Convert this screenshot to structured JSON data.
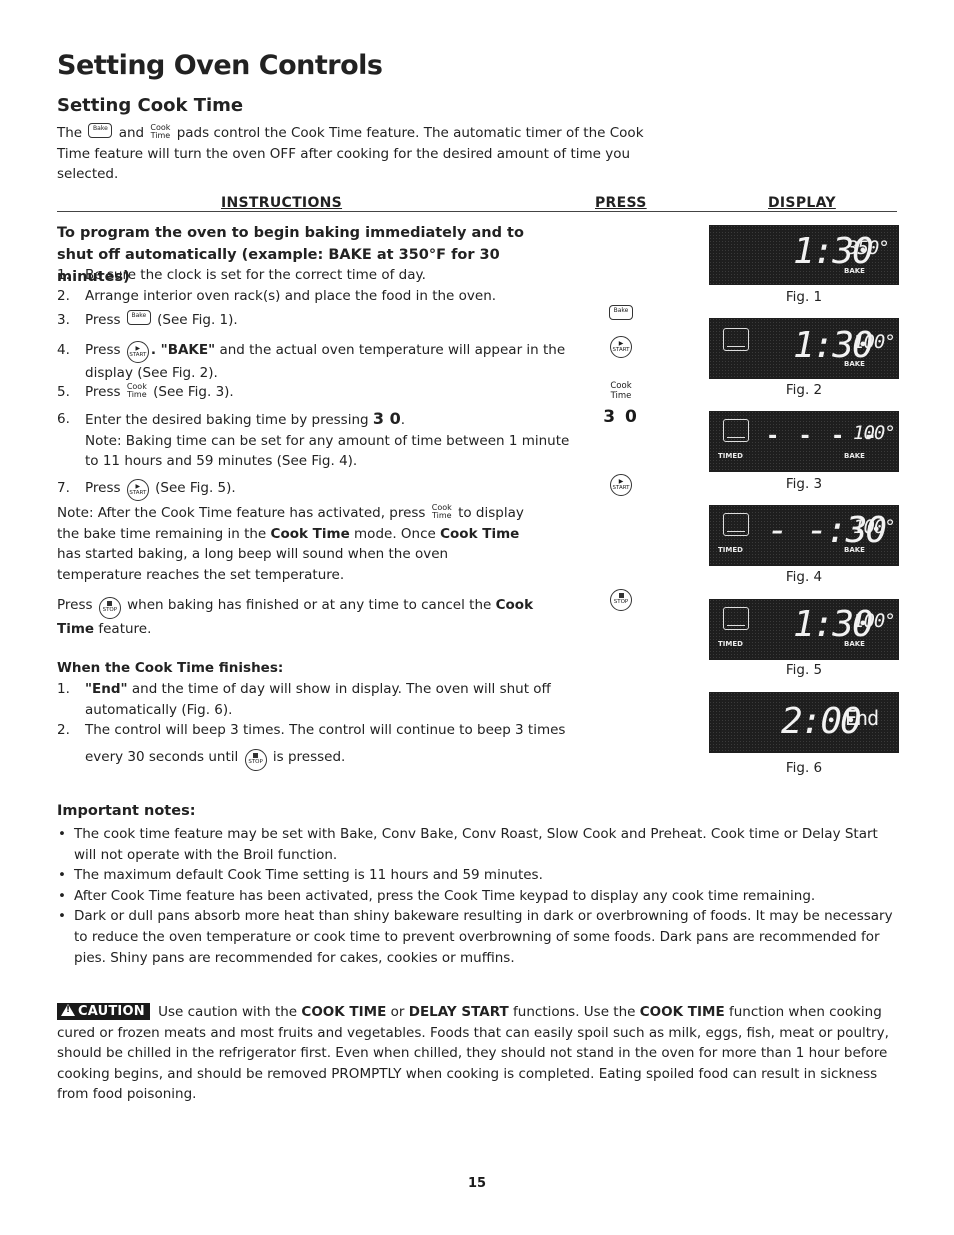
{
  "page": {
    "title": "Setting Oven Controls",
    "subtitle": "Setting Cook Time",
    "page_number": "15"
  },
  "intro": {
    "part1": "The",
    "bake_pad": "Bake",
    "part2": "and",
    "cook_time_pad": [
      "Cook",
      "Time"
    ],
    "part3": "pads control the Cook Time feature. The automatic timer of the Cook Time feature will turn the oven OFF after cooking for the desired amount of time you selected."
  },
  "columns": {
    "instructions": "INSTRUCTIONS",
    "press": "PRESS",
    "display": "DISPLAY"
  },
  "pads": {
    "bake": "Bake",
    "start": "START",
    "stop": "STOP",
    "cook": "Cook",
    "time": "Time"
  },
  "program": {
    "heading": "To program the oven to begin baking immediately and to shut off automatically (example: BAKE at 350°F for 30 minutes)",
    "steps": [
      {
        "num": "1.",
        "text": "Be sure the clock is set for the correct time of day."
      },
      {
        "num": "2.",
        "text": "Arrange interior oven rack(s) and place the food in the oven."
      },
      {
        "num": "3.",
        "pre": "Press",
        "post": "(See Fig. 1)."
      },
      {
        "num": "4.",
        "pre": "Press",
        "bold": ". \"BAKE\"",
        "post": " and the actual oven temperature will appear in the display (See Fig. 2)."
      },
      {
        "num": "5.",
        "pre": "Press",
        "post": "(See Fig. 3)."
      },
      {
        "num": "6.",
        "pre": "Enter the desired baking time by pressing",
        "bold": "3 0",
        "post": ".",
        "note": "Note: Baking time can be set for any amount of time between 1 minute to 11 hours and 59 minutes (See Fig. 4)."
      },
      {
        "num": "7.",
        "pre": "Press",
        "post": "(See Fig. 5)."
      }
    ],
    "note_after": {
      "a": "Note: After the Cook Time feature has activated, press",
      "b": "to display the bake time remaining in the",
      "b_bold": "Cook Time",
      "c": "mode. Once",
      "c_bold": "Cook Time",
      "d": "has started baking, a long beep will sound when the oven temperature reaches the set temperature."
    },
    "cancel": {
      "pre": "Press",
      "mid": "when baking has finished or at any time to cancel the",
      "bold": "Cook Time",
      "post": "feature."
    },
    "press_digits": "3 0"
  },
  "finish": {
    "heading": "When the Cook Time finishes:",
    "steps": [
      {
        "num": "1.",
        "bold": "\"End\"",
        "text": " and the time of day will show in display. The oven will shut off automatically (Fig. 6)."
      },
      {
        "num": "2.",
        "text": "The control will beep 3 times. The control will continue to beep 3 times every 30 seconds until",
        "post": "is pressed."
      }
    ]
  },
  "displays": [
    {
      "fig": "Fig. 1",
      "time": "1:30",
      "temp": "350°",
      "mode": "BAKE",
      "timed": "",
      "oven_icon": false
    },
    {
      "fig": "Fig. 2",
      "time": "1:30",
      "temp": "100°",
      "mode": "BAKE",
      "timed": "",
      "oven_icon": true
    },
    {
      "fig": "Fig. 3",
      "time": "- - - -",
      "temp": "100°",
      "mode": "BAKE",
      "timed": "TIMED",
      "oven_icon": true
    },
    {
      "fig": "Fig. 4",
      "time": "- -:30",
      "temp": "100°",
      "mode": "BAKE",
      "timed": "TIMED",
      "oven_icon": true
    },
    {
      "fig": "Fig. 5",
      "time": "1:30",
      "temp": "100°",
      "mode": "BAKE",
      "timed": "TIMED",
      "oven_icon": true
    },
    {
      "fig": "Fig. 6",
      "time": "2:00",
      "temp": "End",
      "mode": "",
      "timed": "",
      "oven_icon": false
    }
  ],
  "notes": {
    "heading": "Important notes:",
    "items": [
      "The cook time feature may be set with Bake, Conv Bake, Conv Roast, Slow Cook and Preheat. Cook time or Delay Start will not operate with the Broil function.",
      "The maximum default Cook Time setting is 11 hours and 59 minutes.",
      "After Cook Time feature has been activated, press the Cook Time keypad to display any cook time remaining.",
      "Dark or dull pans absorb more heat than shiny bakeware resulting in dark or overbrowning of foods. It may be necessary to reduce the oven temperature or cook time to prevent overbrowning of some foods. Dark pans are recommended for pies. Shiny pans are recommended for cakes, cookies or muffins."
    ]
  },
  "caution": {
    "badge": "CAUTION",
    "t1": "Use caution with the",
    "b1": "COOK TIME",
    "t2": "or",
    "b2": "DELAY START",
    "t3": "functions. Use the",
    "b3": "COOK TIME",
    "t4": "function when cooking cured or frozen meats and most fruits and vegetables. Foods that can easily spoil such as milk, eggs, fish, meat or poultry, should be chilled in the refrigerator first. Even when chilled, they should not stand in the oven for more than 1 hour before cooking begins, and should be removed PROMPTLY when cooking is completed. Eating spoiled food can result in sickness from food poisoning."
  }
}
